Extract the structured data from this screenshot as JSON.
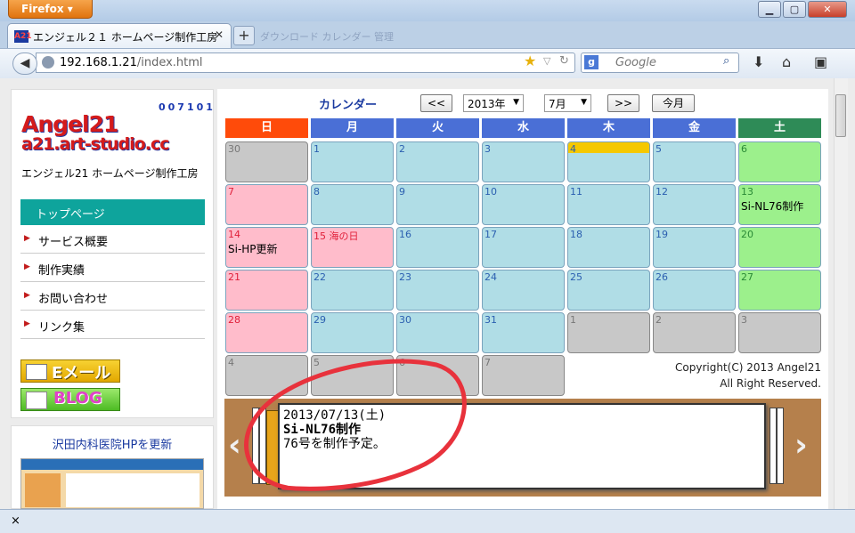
{
  "browser": {
    "menu_label": "Firefox",
    "tab1_title": "エンジェル２１ ホームページ制作工房",
    "tab1_favicon": "A21",
    "tab2_title": "ダウンロード カレンダー 管理",
    "url_host": "192.168.1.21",
    "url_path": "/index.html",
    "search_placeholder": "Google",
    "status_close": "×"
  },
  "sidebar": {
    "counter": "007101",
    "logo_line1": "Angel21",
    "logo_line2": "a21.art-studio.cc",
    "tagline": "エンジェル21 ホームページ制作工房",
    "active_item": "トップページ",
    "items": [
      "サービス概要",
      "制作実績",
      "お問い合わせ",
      "リンク集"
    ],
    "email_label": "Eメール",
    "blog_label": "BLOG",
    "link_title": "沢田内科医院HPを更新"
  },
  "calendar": {
    "title": "カレンダー",
    "prev_label": "<<",
    "next_label": ">>",
    "year_value": "2013年",
    "month_value": "7月",
    "today_label": "今月",
    "weekdays": [
      "日",
      "月",
      "火",
      "水",
      "木",
      "金",
      "土"
    ],
    "weekday_colors": [
      "#ff4b0a",
      "#4a6fd6",
      "#4a6fd6",
      "#4a6fd6",
      "#4a6fd6",
      "#4a6fd6",
      "#2e8b57"
    ],
    "weeks": [
      [
        {
          "d": "30",
          "t": "o"
        },
        {
          "d": "1",
          "t": "w"
        },
        {
          "d": "2",
          "t": "w"
        },
        {
          "d": "3",
          "t": "w"
        },
        {
          "d": "4",
          "t": "today"
        },
        {
          "d": "5",
          "t": "w"
        },
        {
          "d": "6",
          "t": "sat"
        }
      ],
      [
        {
          "d": "7",
          "t": "sun"
        },
        {
          "d": "8",
          "t": "w"
        },
        {
          "d": "9",
          "t": "w"
        },
        {
          "d": "10",
          "t": "w"
        },
        {
          "d": "11",
          "t": "w"
        },
        {
          "d": "12",
          "t": "w"
        },
        {
          "d": "13",
          "t": "sat",
          "ev": "Si-NL76制作"
        }
      ],
      [
        {
          "d": "14",
          "t": "sun",
          "ev": "Si-HP更新"
        },
        {
          "d": "15 海の日",
          "t": "hol"
        },
        {
          "d": "16",
          "t": "w"
        },
        {
          "d": "17",
          "t": "w"
        },
        {
          "d": "18",
          "t": "w"
        },
        {
          "d": "19",
          "t": "w"
        },
        {
          "d": "20",
          "t": "sat"
        }
      ],
      [
        {
          "d": "21",
          "t": "sun"
        },
        {
          "d": "22",
          "t": "w"
        },
        {
          "d": "23",
          "t": "w"
        },
        {
          "d": "24",
          "t": "w"
        },
        {
          "d": "25",
          "t": "w"
        },
        {
          "d": "26",
          "t": "w"
        },
        {
          "d": "27",
          "t": "sat"
        }
      ],
      [
        {
          "d": "28",
          "t": "sun"
        },
        {
          "d": "29",
          "t": "w"
        },
        {
          "d": "30",
          "t": "w"
        },
        {
          "d": "31",
          "t": "w"
        },
        {
          "d": "1",
          "t": "o"
        },
        {
          "d": "2",
          "t": "o"
        },
        {
          "d": "3",
          "t": "o"
        }
      ],
      [
        {
          "d": "4",
          "t": "o"
        },
        {
          "d": "5",
          "t": "o"
        },
        {
          "d": "6",
          "t": "o"
        },
        {
          "d": "7",
          "t": "o"
        }
      ]
    ],
    "copyright_line1": "Copyright(C) 2013 Angel21",
    "copyright_line2": "All Right Reserved."
  },
  "note": {
    "line1": "2013/07/13(土)",
    "line2": "Si-NL76制作",
    "line3": "76号を制作予定。"
  },
  "colors": {
    "weekday_cell": "#b0dde6",
    "sunday_cell": "#ffbccb",
    "saturday_cell": "#9cf08c",
    "other_month_cell": "#c8c8c8",
    "today_marker": "#f5c800",
    "sidebar_active": "#0ea49c",
    "annotation_circle": "#e8323c"
  }
}
